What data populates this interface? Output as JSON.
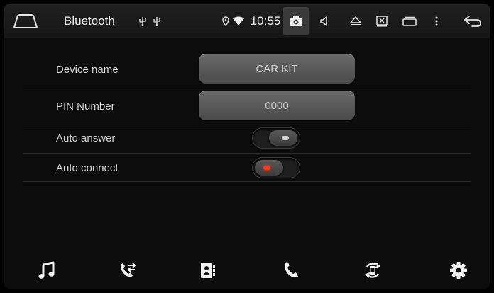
{
  "statusbar": {
    "title": "Bluetooth",
    "time": "10:55"
  },
  "settings": {
    "device_name": {
      "label": "Device name",
      "value": "CAR KIT"
    },
    "pin_number": {
      "label": "PIN Number",
      "value": "0000"
    },
    "auto_answer": {
      "label": "Auto answer",
      "enabled": false
    },
    "auto_connect": {
      "label": "Auto connect",
      "enabled": true
    }
  },
  "colors": {
    "toggle_on": "#ff3b1f",
    "toggle_off": "#d0d0d0"
  },
  "bottom_nav": [
    {
      "icon": "music-note-icon"
    },
    {
      "icon": "call-transfer-icon"
    },
    {
      "icon": "contacts-book-icon"
    },
    {
      "icon": "phone-icon"
    },
    {
      "icon": "sync-device-icon"
    },
    {
      "icon": "gear-icon"
    }
  ]
}
